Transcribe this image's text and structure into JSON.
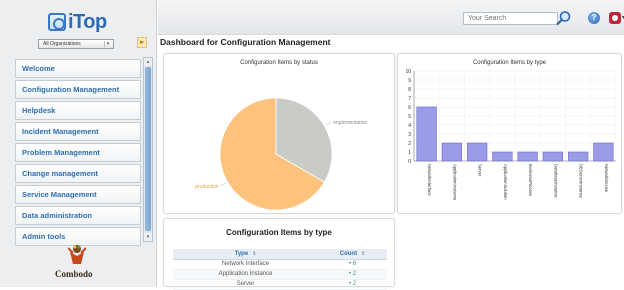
{
  "app": {
    "logo_text": "iTop",
    "org_selector": "All Organizations"
  },
  "header": {
    "search_placeholder": "Your Search"
  },
  "page": {
    "title": "Dashboard for Configuration Management"
  },
  "menu": {
    "items": [
      "Welcome",
      "Configuration Management",
      "Helpdesk",
      "Incident Management",
      "Problem Management",
      "Change management",
      "Service Management",
      "Data administration",
      "Admin tools"
    ]
  },
  "branding": {
    "vendor": "Combodo"
  },
  "icons": {
    "search": "search-icon",
    "help": "help-icon",
    "user": "user-menu-icon",
    "menu_toggle": "pin-icon"
  },
  "colors": {
    "accent": "#2f6fb0",
    "pie_production": "#fdc27c",
    "pie_implementation": "#c8cbc6",
    "bar": "#9b9be8"
  },
  "chart_data": [
    {
      "type": "pie",
      "title": "Configuration Items by status",
      "slices": [
        {
          "label": "production",
          "value": 12
        },
        {
          "label": "implementation",
          "value": 6
        }
      ]
    },
    {
      "type": "bar",
      "title": "Configuration Items by type",
      "categories": [
        "NetworkInterface",
        "ApplicationInstance",
        "Server",
        "ApplicationSolution",
        "BusinessProcess",
        "DatabaseInstance",
        "DBServerInstance",
        "NetworkDevice"
      ],
      "values": [
        6,
        2,
        2,
        1,
        1,
        1,
        1,
        2
      ],
      "ylim": [
        0,
        10
      ],
      "yticks": [
        "0",
        "1",
        "2",
        "3",
        "4",
        "5",
        "6",
        "7",
        "8",
        "9",
        "10"
      ],
      "grid": true
    }
  ],
  "table": {
    "title": "Configuration Items by type",
    "headers": [
      "Type",
      "Count"
    ],
    "rows": [
      {
        "type": "Network Interface",
        "count": "6"
      },
      {
        "type": "Application Instance",
        "count": "2"
      },
      {
        "type": "Server",
        "count": "2"
      }
    ]
  }
}
